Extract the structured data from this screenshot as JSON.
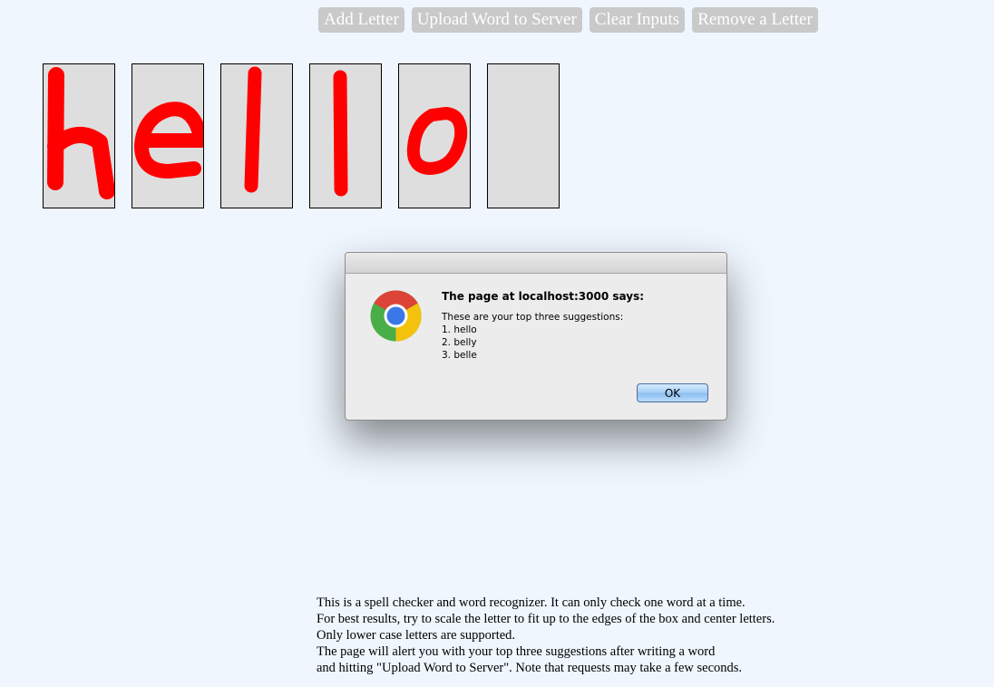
{
  "toolbar": {
    "add_letter": "Add Letter",
    "upload_word": "Upload Word to Server",
    "clear_inputs": "Clear Inputs",
    "remove_letter": "Remove a Letter"
  },
  "letters": [
    {
      "drawn": "h"
    },
    {
      "drawn": "e"
    },
    {
      "drawn": "l"
    },
    {
      "drawn": "l"
    },
    {
      "drawn": "o"
    },
    {
      "drawn": ""
    }
  ],
  "stroke_color": "#ff0000",
  "alert": {
    "title": "The page at localhost:3000 says:",
    "intro": "These are your top three suggestions:",
    "suggestions": [
      "1. hello",
      "2. belly",
      "3. belle"
    ],
    "ok_label": "OK",
    "icon": "chrome-icon"
  },
  "instructions": [
    "This is a spell checker and word recognizer. It can only check one word at a time.",
    "For best results, try to scale the letter to fit up to the edges of the box and center letters.",
    "Only lower case letters are supported.",
    "The page will alert you with your top three suggestions after writing a word",
    "and hitting \"Upload Word to Server\". Note that requests may take a few seconds."
  ]
}
